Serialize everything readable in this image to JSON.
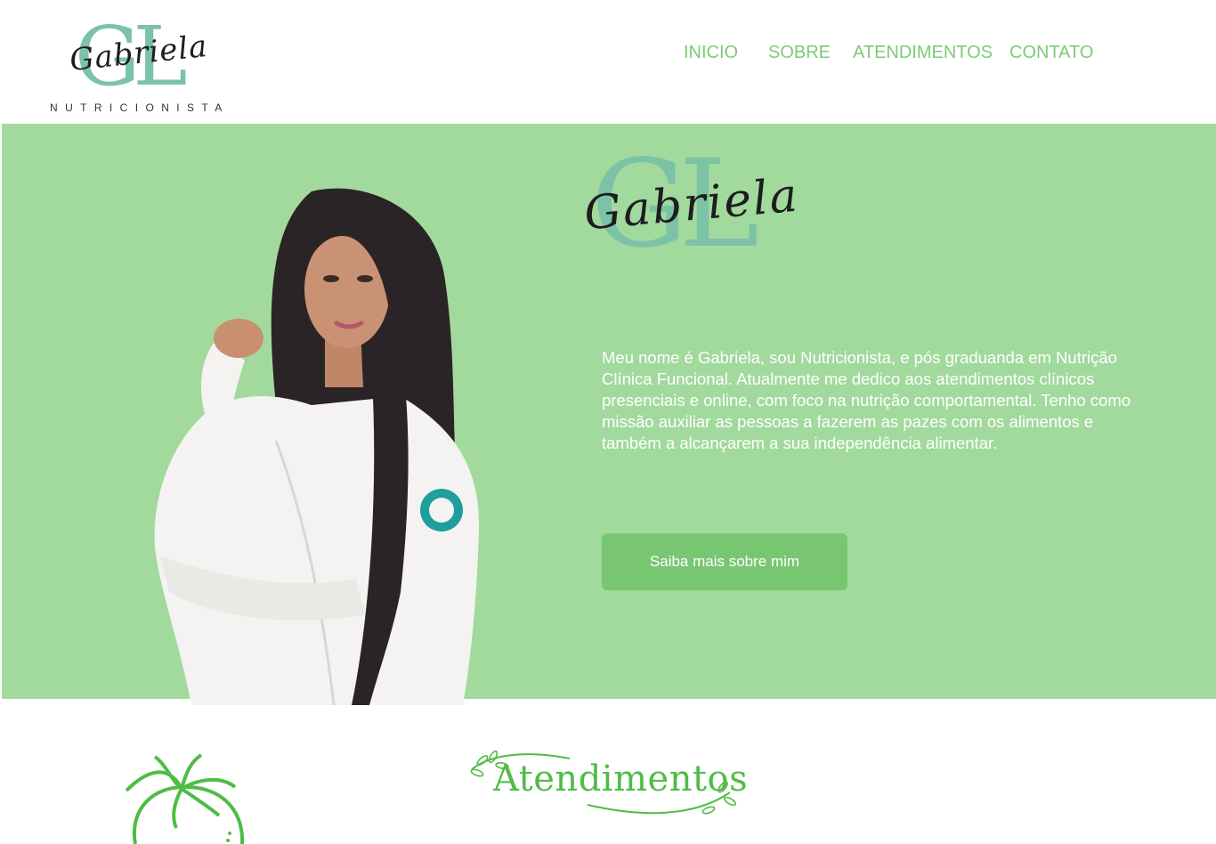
{
  "brand": {
    "monogram": "GL",
    "script_name": "Gabriela",
    "subtitle": "NUTRICIONISTA"
  },
  "nav": {
    "items": [
      {
        "label": "INICIO"
      },
      {
        "label": "SOBRE"
      },
      {
        "label": "ATENDIMENTOS"
      },
      {
        "label": "CONTATO"
      }
    ]
  },
  "hero": {
    "monogram": "GL",
    "script_name": "Gabriela",
    "description": "Meu nome é Gabriela, sou Nutricionista, e pós graduanda em Nutrição Clínica Funcional. Atualmente me dedico aos atendimentos clínicos presenciais e online, com foco na nutrição comportamental.  Tenho como missão auxiliar as pessoas a fazerem as pazes com os alimentos e também a alcançarem a sua independência alimentar.",
    "cta_label": "Saiba mais sobre mim"
  },
  "services": {
    "title": "Atendimentos"
  },
  "colors": {
    "hero_bg": "#a2d99d",
    "nav_text": "#7dca77",
    "button_bg": "#79c672",
    "monogram": "#7cc2a6",
    "section_title": "#4fbc46"
  },
  "icons": {
    "fruit": "tomato-icon",
    "vine": "leaf-vine-icon"
  }
}
